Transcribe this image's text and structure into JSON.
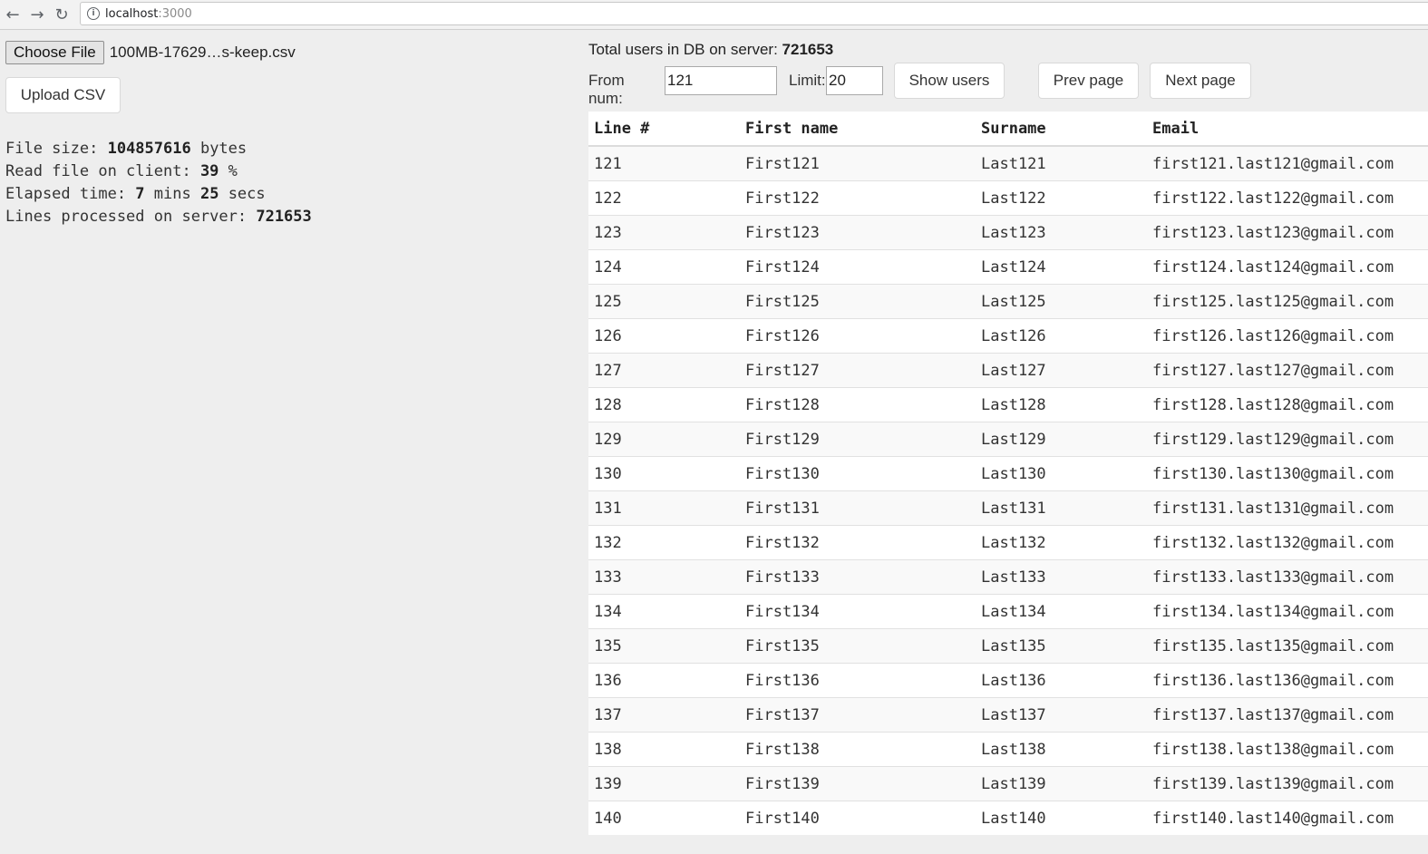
{
  "browser": {
    "url_host": "localhost",
    "url_port": ":3000"
  },
  "upload": {
    "choose_file_label": "Choose File",
    "file_name": "100MB-17629…s-keep.csv",
    "upload_button": "Upload CSV"
  },
  "stats": {
    "file_size_label": "File size: ",
    "file_size_value": "104857616",
    "file_size_unit": " bytes",
    "read_label": "Read file on client: ",
    "read_value": "39",
    "read_unit": " %",
    "elapsed_label": "Elapsed time: ",
    "elapsed_mins": "7",
    "elapsed_mins_unit": " mins ",
    "elapsed_secs": "25",
    "elapsed_secs_unit": " secs",
    "lines_label": "Lines processed on server: ",
    "lines_value": "721653"
  },
  "db": {
    "total_label": "Total users in DB on server: ",
    "total_value": "721653",
    "from_label": "From num:",
    "from_value": "121",
    "limit_label": "Limit:",
    "limit_value": "20",
    "show_button": "Show users",
    "prev_button": "Prev page",
    "next_button": "Next page"
  },
  "table": {
    "headers": [
      "Line #",
      "First name",
      "Surname",
      "Email"
    ],
    "rows": [
      [
        "121",
        "First121",
        "Last121",
        "first121.last121@gmail.com"
      ],
      [
        "122",
        "First122",
        "Last122",
        "first122.last122@gmail.com"
      ],
      [
        "123",
        "First123",
        "Last123",
        "first123.last123@gmail.com"
      ],
      [
        "124",
        "First124",
        "Last124",
        "first124.last124@gmail.com"
      ],
      [
        "125",
        "First125",
        "Last125",
        "first125.last125@gmail.com"
      ],
      [
        "126",
        "First126",
        "Last126",
        "first126.last126@gmail.com"
      ],
      [
        "127",
        "First127",
        "Last127",
        "first127.last127@gmail.com"
      ],
      [
        "128",
        "First128",
        "Last128",
        "first128.last128@gmail.com"
      ],
      [
        "129",
        "First129",
        "Last129",
        "first129.last129@gmail.com"
      ],
      [
        "130",
        "First130",
        "Last130",
        "first130.last130@gmail.com"
      ],
      [
        "131",
        "First131",
        "Last131",
        "first131.last131@gmail.com"
      ],
      [
        "132",
        "First132",
        "Last132",
        "first132.last132@gmail.com"
      ],
      [
        "133",
        "First133",
        "Last133",
        "first133.last133@gmail.com"
      ],
      [
        "134",
        "First134",
        "Last134",
        "first134.last134@gmail.com"
      ],
      [
        "135",
        "First135",
        "Last135",
        "first135.last135@gmail.com"
      ],
      [
        "136",
        "First136",
        "Last136",
        "first136.last136@gmail.com"
      ],
      [
        "137",
        "First137",
        "Last137",
        "first137.last137@gmail.com"
      ],
      [
        "138",
        "First138",
        "Last138",
        "first138.last138@gmail.com"
      ],
      [
        "139",
        "First139",
        "Last139",
        "first139.last139@gmail.com"
      ],
      [
        "140",
        "First140",
        "Last140",
        "first140.last140@gmail.com"
      ]
    ]
  }
}
